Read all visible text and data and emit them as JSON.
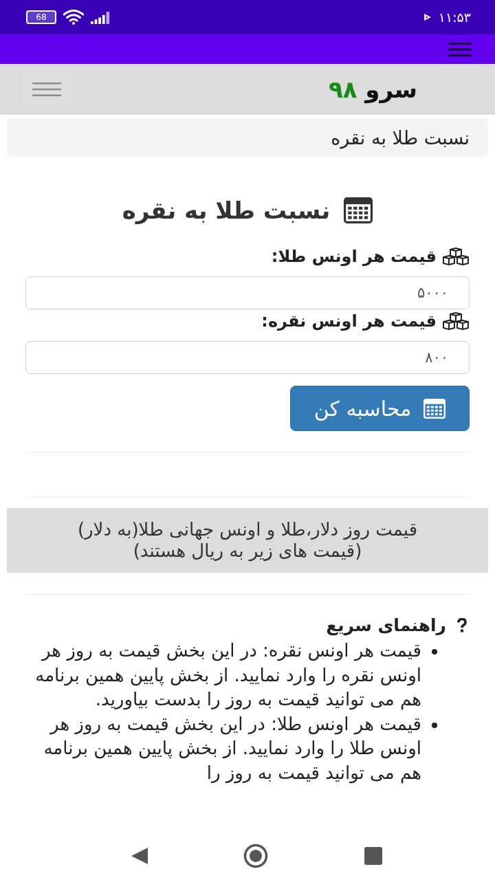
{
  "status_bar": {
    "time": "۱۱:۵۳",
    "battery": "68"
  },
  "site_header": {
    "logo_word": "سرو",
    "logo_number": "۹۸"
  },
  "breadcrumb": "نسبت طلا به نقره",
  "calculator": {
    "title": "نسبت طلا به نقره",
    "fields": [
      {
        "label": "قیمت هر اونس طلا:",
        "value": "۵۰۰۰"
      },
      {
        "label": "قیمت هر اونس نقره:",
        "value": "۸۰۰"
      }
    ],
    "button": "محاسبه کن"
  },
  "price_banner": {
    "lines": [
      "قیمت روز دلار،طلا و اونس جهانی طلا(به دلار)",
      "(قیمت های زیر به ریال هستند)"
    ]
  },
  "help": {
    "title": "راهنمای سریع",
    "items": [
      "قیمت هر اونس نقره: در این بخش قیمت به روز هر اونس نقره را وارد نمایید. از بخش پایین همین برنامه هم می توانید قیمت به روز را بدست بیاورید.",
      "قیمت هر اونس طلا: در این بخش قیمت به روز هر اونس طلا را وارد نمایید. از بخش پایین همین برنامه هم می توانید قیمت به روز را"
    ]
  }
}
